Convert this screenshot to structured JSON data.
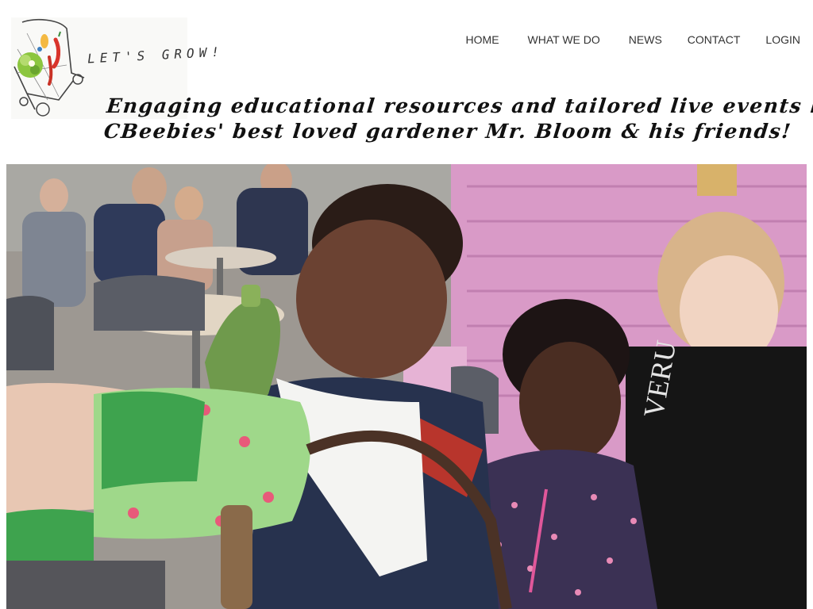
{
  "brand": {
    "logo_text": "LET'S GROW!"
  },
  "nav": {
    "items": [
      {
        "label": "HOME",
        "key": "home"
      },
      {
        "label": "WHAT WE DO",
        "key": "what-we-do"
      },
      {
        "label": "NEWS",
        "key": "news"
      },
      {
        "label": "CONTACT",
        "key": "contact"
      },
      {
        "label": "LOGIN",
        "key": "login"
      }
    ]
  },
  "tagline": {
    "line1": "Engaging educational resources and tailored live events led by",
    "line2": "CBeebies' best loved gardener Mr. Bloom & his friends!"
  },
  "hero": {
    "alt": "Children at an outdoor cafe, a boy looking at a courgette held by a gloved puppet hand",
    "colors": {
      "pink_wall": "#d99ac7",
      "glove_green": "#3ea34e",
      "courgette": "#6f9a4c"
    }
  }
}
